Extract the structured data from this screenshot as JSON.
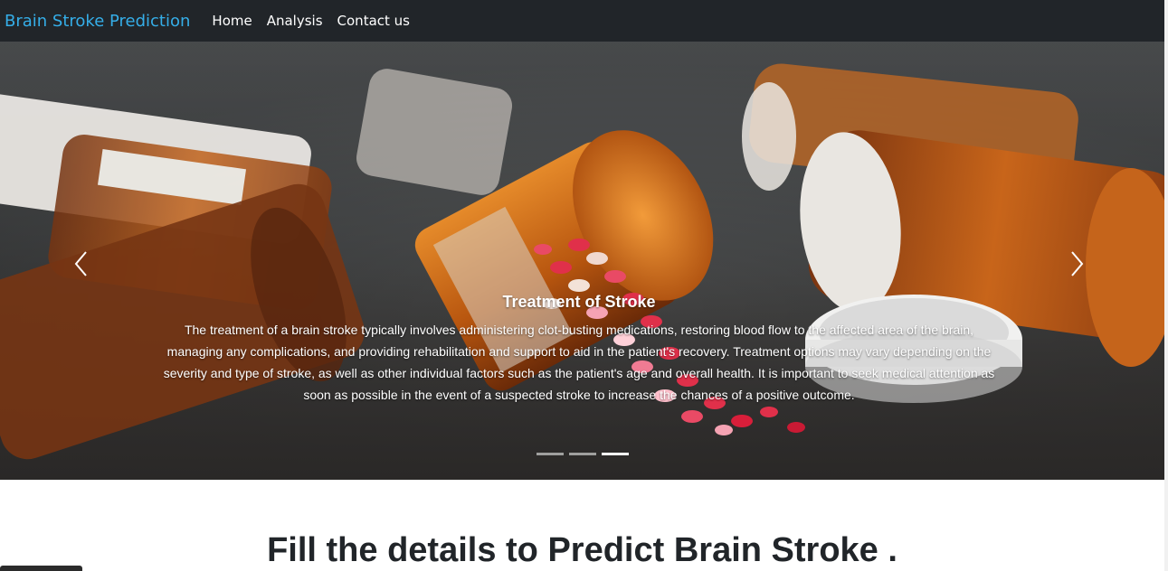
{
  "navbar": {
    "brand": "Brain Stroke Prediction",
    "links": [
      "Home",
      "Analysis",
      "Contact us"
    ]
  },
  "carousel": {
    "slide_title": "Treatment of Stroke",
    "slide_text": "The treatment of a brain stroke typically involves administering clot-busting medications, restoring blood flow to the affected area of the brain, managing any complications, and providing rehabilitation and support to aid in the patient's recovery. Treatment options may vary depending on the severity and type of stroke, as well as other individual factors such as the patient's age and overall health. It is important to seek medical attention as soon as possible in the event of a suspected stroke to increase the chances of a positive outcome.",
    "indicator_count": 3,
    "active_indicator": 3,
    "icons": {
      "prev": "chevron-left-icon",
      "next": "chevron-right-icon"
    }
  },
  "form_heading": {
    "prefix": "Fill the details to ",
    "emphasis": "Predict Brain Stroke",
    "suffix": " ."
  },
  "colors": {
    "navbar_bg": "#212529",
    "brand": "#35aee8",
    "pill_red": "#e0304a",
    "bottle_orange": "#d9781c"
  }
}
